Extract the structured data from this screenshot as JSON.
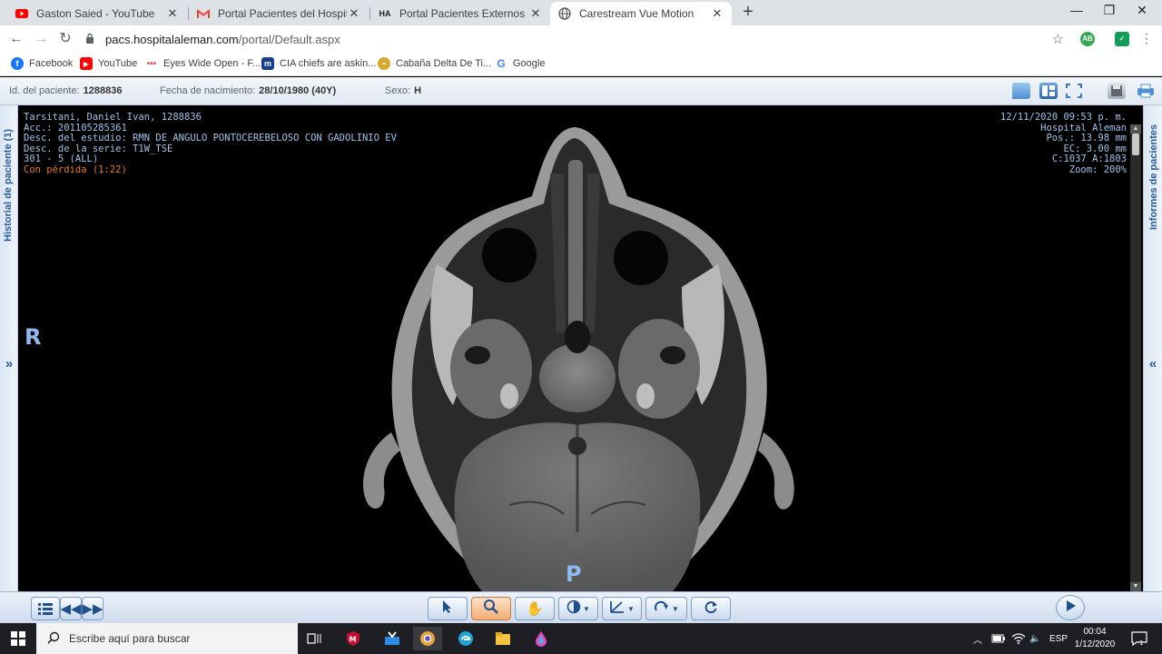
{
  "browser": {
    "tabs": [
      {
        "title": "Gaston Saied - YouTube",
        "icon": "youtube-icon",
        "active": false
      },
      {
        "title": "Portal Pacientes del Hospital Alem",
        "icon": "gmail-icon",
        "active": false
      },
      {
        "title": "Portal Pacientes Externos",
        "icon": "ha-logo-icon",
        "active": false
      },
      {
        "title": "Carestream Vue Motion",
        "icon": "globe-icon",
        "active": true
      }
    ],
    "url_host": "pacs.hospitalaleman.com",
    "url_path": "/portal/Default.aspx",
    "bookmarks": [
      {
        "label": "Facebook",
        "icon": "facebook-icon",
        "color": "#1877f2"
      },
      {
        "label": "YouTube",
        "icon": "youtube-icon",
        "color": "#ff0000"
      },
      {
        "label": "Eyes Wide Open - F...",
        "icon": "dots-icon",
        "color": "#e53935"
      },
      {
        "label": "CIA chiefs are askin...",
        "icon": "m-logo-icon",
        "color": "#1a3e8c"
      },
      {
        "label": "Cabaña Delta De Ti...",
        "icon": "hat-icon",
        "color": "#d4a82a"
      },
      {
        "label": "Google",
        "icon": "google-icon",
        "color": "#4285f4"
      }
    ],
    "extensions": [
      {
        "label": "AB",
        "color": "#34a853"
      },
      {
        "label": "✓",
        "color": "#0f9d58"
      }
    ]
  },
  "patient": {
    "id_label": "Id. del paciente:",
    "id_value": "1288836",
    "dob_label": "Fecha de nacimiento:",
    "dob_value": "28/10/1980 (40Y)",
    "sex_label": "Sexo:",
    "sex_value": "H"
  },
  "side_panels": {
    "left_label": "Historial de paciente (1)",
    "right_label": "Informes de pacientes",
    "left_chevron": "»",
    "right_chevron": "«"
  },
  "overlay": {
    "top_left": [
      "Tarsitani, Daniel Ivan, 1288836",
      "Acc.: 201105285361",
      "Desc. del estudio: RMN DE ANGULO PONTOCEREBELOSO CON GADOLINIO EV",
      "Desc. de la serie: T1W_TSE",
      "301 - 5 (ALL)"
    ],
    "compression": "Con pérdida (1:22)",
    "top_right": [
      "12/11/2020 09:53 p. m.",
      "Hospital Aleman",
      "Pos.: 13.98 mm",
      "EC: 3.00 mm",
      "C:1037 A:1803",
      "Zoom: 200%"
    ],
    "orientation_left": "R",
    "orientation_bottom": "P"
  },
  "toolbar": {
    "colors": {
      "accent": "#1f4f8e",
      "selected": "#f2ad72"
    }
  },
  "taskbar": {
    "search_placeholder": "Escribe aquí para buscar",
    "language": "ESP",
    "time": "00:04",
    "date": "1/12/2020",
    "notifications": "1"
  }
}
